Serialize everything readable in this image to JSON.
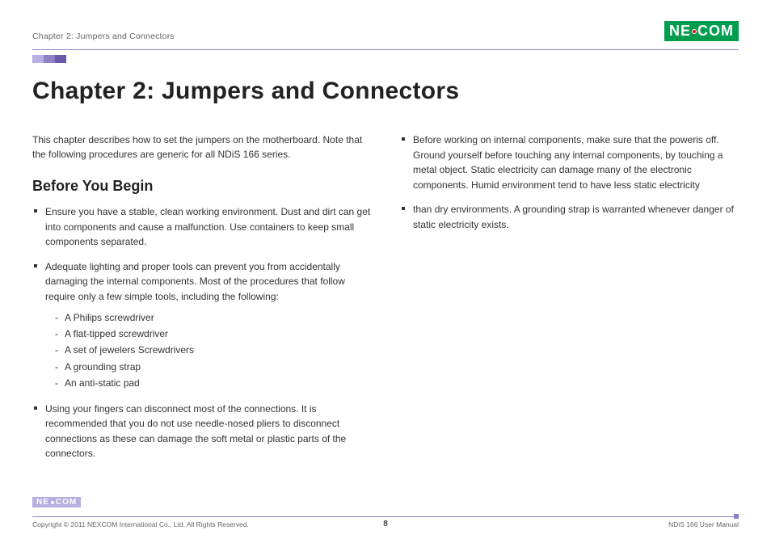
{
  "header": {
    "breadcrumb": "Chapter 2: Jumpers and Connectors",
    "logo_text_left": "NE",
    "logo_text_right": "COM"
  },
  "main": {
    "chapter_title": "Chapter 2: Jumpers and Connectors",
    "intro": "This chapter describes how to set the jumpers on the motherboard. Note that the following procedures are generic for all NDiS 166 series.",
    "section_heading": "Before You Begin",
    "left_bullets": {
      "b1": "Ensure you have a stable, clean working environment. Dust and dirt can get into components and cause a malfunction. Use containers to keep small components separated.",
      "b2": "Adequate lighting and proper tools can prevent you from accidentally damaging the internal components. Most of the procedures that follow require only a few simple tools, including the following:",
      "b2_tools": {
        "t1": "A Philips screwdriver",
        "t2": "A flat-tipped screwdriver",
        "t3": "A set of jewelers Screwdrivers",
        "t4": "A grounding strap",
        "t5": "An anti-static pad"
      },
      "b3": "Using your fingers can disconnect most of the connections. It is recommended that you do not use needle-nosed pliers to disconnect connections as these can damage the soft metal or plastic parts of the connectors."
    },
    "right_bullets": {
      "b1": "Before working on internal components, make sure that the poweris off. Ground yourself before touching any internal components, by touching a metal object. Static electricity can damage many of the electronic components. Humid environment tend to have less static electricity",
      "b2": "than dry environments. A grounding strap is warranted whenever danger of static electricity exists."
    }
  },
  "footer": {
    "logo_left": "NE",
    "logo_right": "COM",
    "copyright": "Copyright © 2011 NEXCOM International Co., Ltd. All Rights Reserved.",
    "page_number": "8",
    "doc_ref": "NDiS 166 User Manual"
  }
}
